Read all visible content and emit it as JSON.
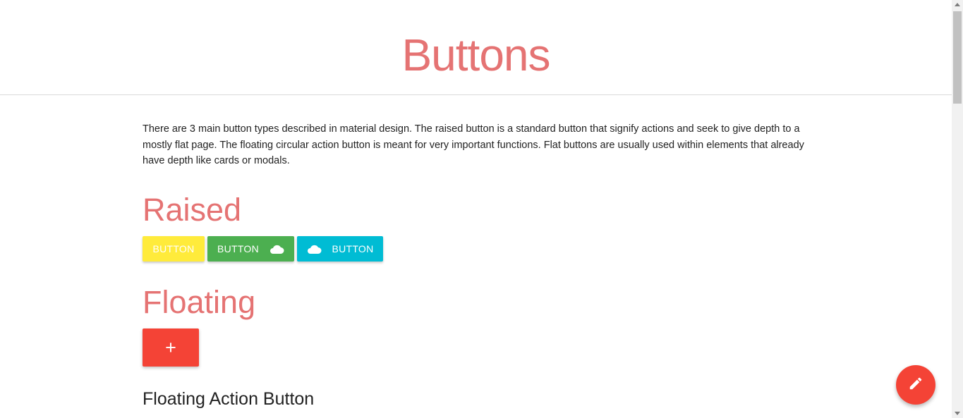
{
  "header": {
    "title": "Buttons"
  },
  "intro": {
    "text": "There are 3 main button types described in material design. The raised button is a standard button that signify actions and seek to give depth to a mostly flat page. The floating circular action button is meant for very important functions. Flat buttons are usually used within elements that already have depth like cards or modals."
  },
  "sections": {
    "raised": {
      "title": "Raised",
      "buttons": [
        {
          "label": "BUTTON",
          "color": "#ffeb3b"
        },
        {
          "label": "BUTTON",
          "color": "#4caf50",
          "icon": "cloud-icon"
        },
        {
          "label": "BUTTON",
          "color": "#00bcd4",
          "icon": "cloud-icon"
        }
      ]
    },
    "floating": {
      "title": "Floating",
      "button_label": "+",
      "color": "#f44336"
    },
    "fab": {
      "heading": "Floating Action Button",
      "icon": "pencil-icon",
      "color": "#f44336"
    }
  },
  "theme": {
    "accent": "#e57373"
  }
}
